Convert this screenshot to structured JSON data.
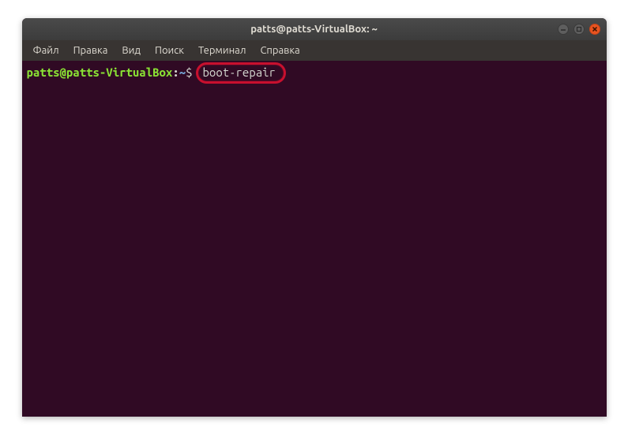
{
  "titlebar": {
    "title": "patts@patts-VirtualBox: ~"
  },
  "menubar": {
    "items": [
      "Файл",
      "Правка",
      "Вид",
      "Поиск",
      "Терминал",
      "Справка"
    ]
  },
  "terminal": {
    "prompt": {
      "user_host": "patts@patts-VirtualBox",
      "colon": ":",
      "path": "~",
      "dollar": "$"
    },
    "command": "boot-repair"
  },
  "colors": {
    "terminal_bg": "#300a24",
    "prompt_user": "#8ae234",
    "prompt_path": "#729fcf",
    "text": "#d3d7cf",
    "highlight_border": "#c8102e",
    "close_btn": "#e95420"
  }
}
